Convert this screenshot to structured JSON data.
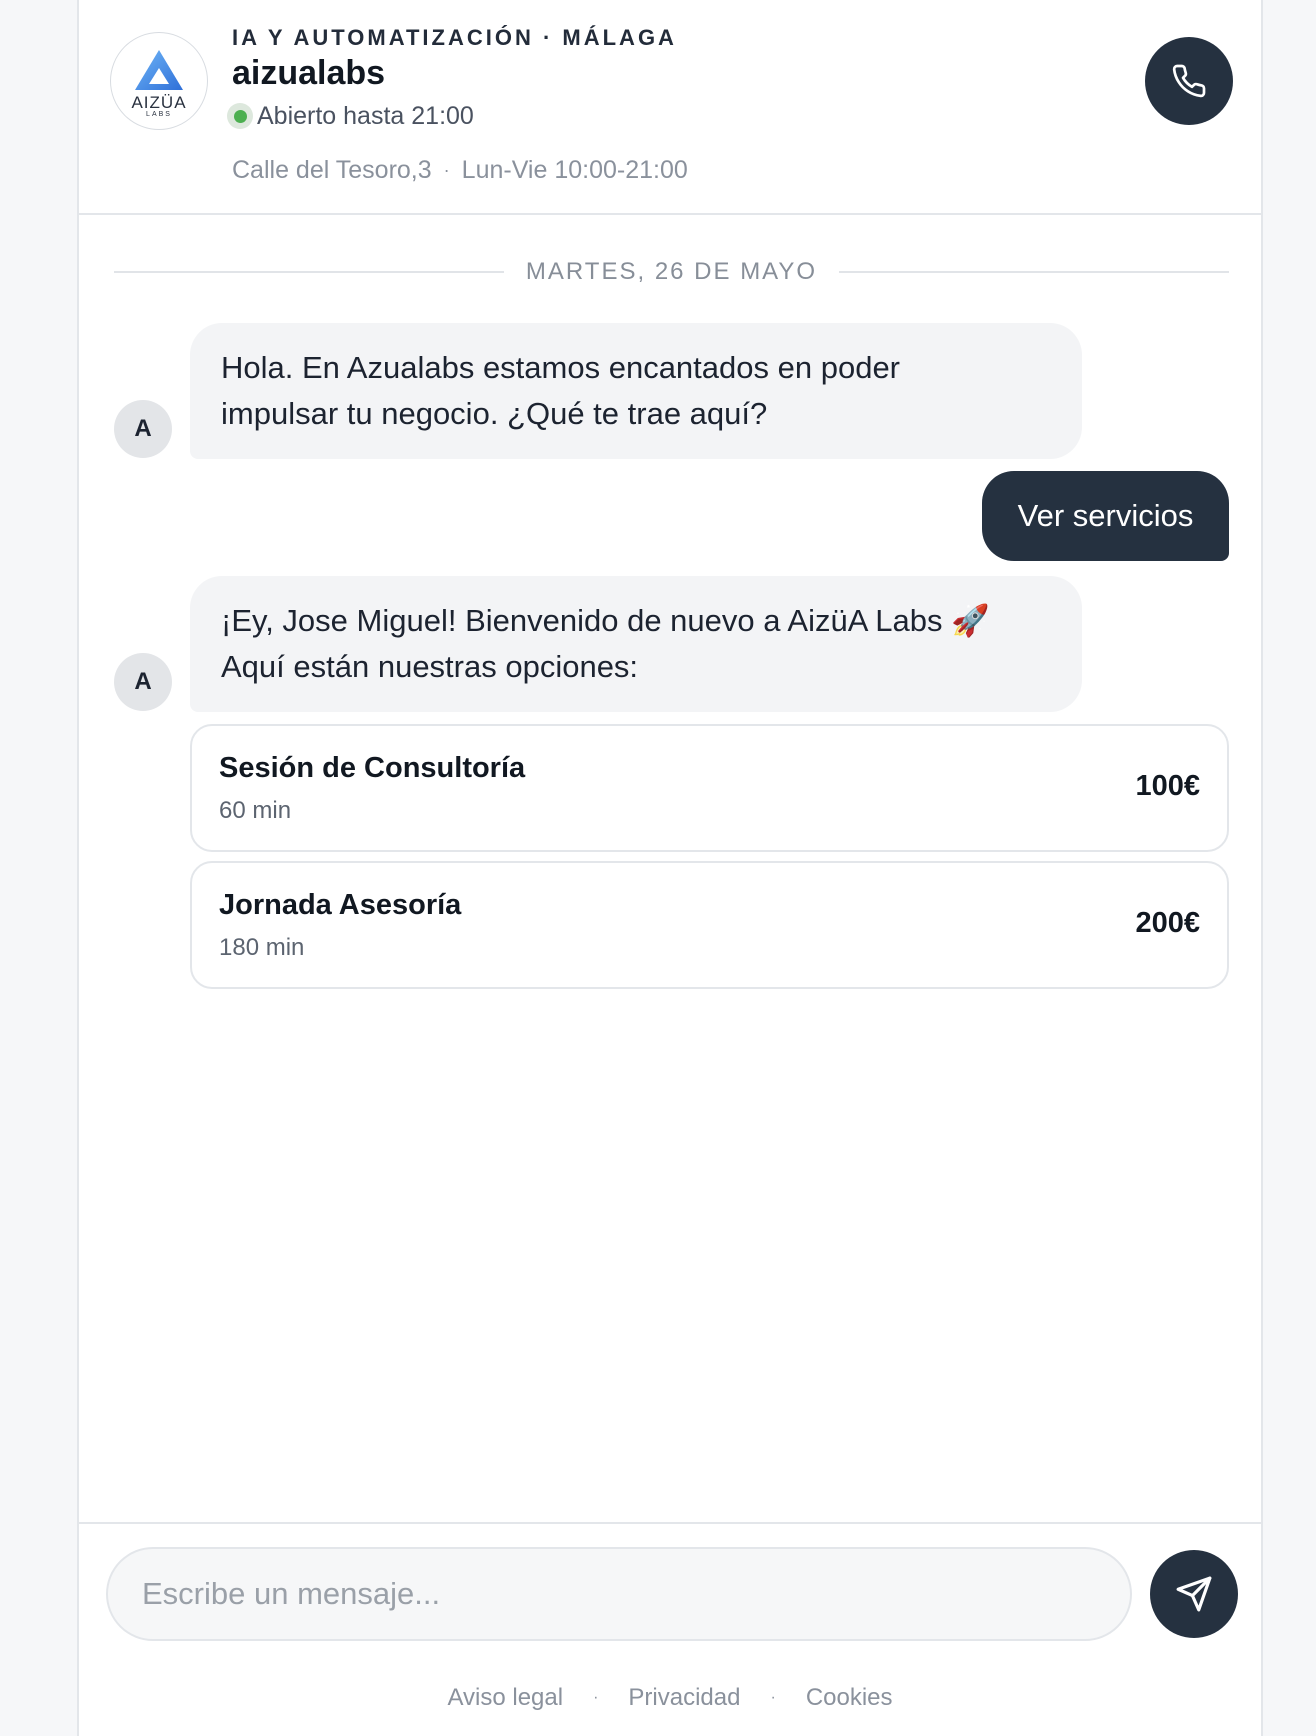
{
  "business": {
    "logo_word": "AIZÜA",
    "logo_sub": "LABS",
    "category": "IA Y AUTOMATIZACIÓN · MÁLAGA",
    "name": "aizualabs",
    "status": "Abierto hasta 21:00",
    "address": "Calle del Tesoro,3",
    "separator": "·",
    "hours": "Lun-Vie 10:00-21:00"
  },
  "date_separator": "MARTES, 26 DE MAYO",
  "messages": [
    {
      "sender": "bot",
      "avatar": "A",
      "lines": [
        "Hola. En Azualabs estamos encantados en poder",
        "impulsar tu negocio. ¿Qué te trae aquí?"
      ]
    },
    {
      "sender": "user",
      "text": "Ver servicios"
    },
    {
      "sender": "bot",
      "avatar": "A",
      "lines": [
        "¡Ey, Jose Miguel! Bienvenido de nuevo a AizüA Labs 🚀",
        "Aquí están nuestras opciones:"
      ]
    }
  ],
  "services": [
    {
      "name": "Sesión de Consultoría",
      "duration": "60 min",
      "price": "100€"
    },
    {
      "name": "Jornada Asesoría",
      "duration": "180 min",
      "price": "200€"
    }
  ],
  "composer": {
    "placeholder": "Escribe un mensaje..."
  },
  "footer": {
    "links": [
      "Aviso legal",
      "Privacidad",
      "Cookies"
    ],
    "separator": "·"
  },
  "icons": {
    "call": "phone-icon",
    "send": "send-icon",
    "status": "status-dot-icon"
  },
  "colors": {
    "primary": "#253140",
    "status_green": "#4caf50",
    "logo_blue": "#3b82f6"
  }
}
